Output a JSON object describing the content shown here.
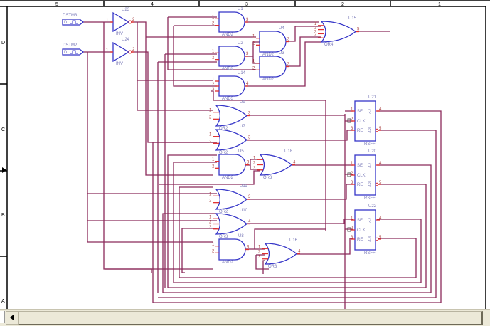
{
  "frame": {
    "columns": [
      "5",
      "4",
      "3",
      "2",
      "1"
    ],
    "rows": [
      "D",
      "C",
      "B",
      "A"
    ]
  },
  "stimuli": [
    {
      "ref": "DSTM3",
      "pin": "D"
    },
    {
      "ref": "DSTM2",
      "pin": "D"
    }
  ],
  "components": {
    "u23": {
      "ref": "U23",
      "type": "INV"
    },
    "u24": {
      "ref": "U24",
      "type": "INV"
    },
    "u1": {
      "ref": "U1",
      "type": "AND2"
    },
    "u2": {
      "ref": "U2",
      "type": "AND2"
    },
    "u4": {
      "ref": "U4",
      "type": "AND2"
    },
    "u3": {
      "ref": "U3",
      "type": "AND2"
    },
    "u14": {
      "ref": "U14",
      "type": "AND3"
    },
    "u15": {
      "ref": "U15",
      "type": "OR4"
    },
    "u9": {
      "ref": "U9",
      "type": "OR2"
    },
    "u7": {
      "ref": "U7",
      "type": "OR2"
    },
    "u5": {
      "ref": "U5",
      "type": "AND2"
    },
    "u18": {
      "ref": "U18",
      "type": "OR3"
    },
    "u11": {
      "ref": "U11",
      "type": "OR2"
    },
    "u10": {
      "ref": "U10",
      "type": "OR3"
    },
    "u8": {
      "ref": "U8",
      "type": "AND2"
    },
    "u16": {
      "ref": "U16",
      "type": "OR3"
    },
    "u21": {
      "ref": "U21",
      "type": "RSFF"
    },
    "u20": {
      "ref": "U20",
      "type": "RSFF"
    },
    "u22": {
      "ref": "U22",
      "type": "RSFF"
    }
  },
  "ff_pins": {
    "se": "SE",
    "clk": "CLK",
    "re": "RE",
    "q": "Q",
    "qbar": "Q"
  },
  "colors": {
    "wire": "#8b2a5a",
    "part": "#3535c8",
    "pin": "#e03030",
    "scrollbar": "#ece9d8"
  }
}
